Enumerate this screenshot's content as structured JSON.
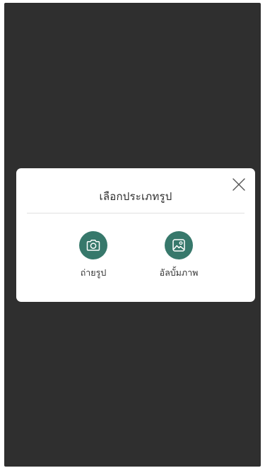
{
  "modal": {
    "title": "เลือกประเภทรูป",
    "close_icon": "close-icon",
    "options": [
      {
        "label": "ถ่ายรูป",
        "icon": "camera-icon"
      },
      {
        "label": "อัลบั้มภาพ",
        "icon": "image-icon"
      }
    ]
  },
  "colors": {
    "overlay": "#2f2f2f",
    "accent": "#37786b",
    "card": "#ffffff"
  }
}
